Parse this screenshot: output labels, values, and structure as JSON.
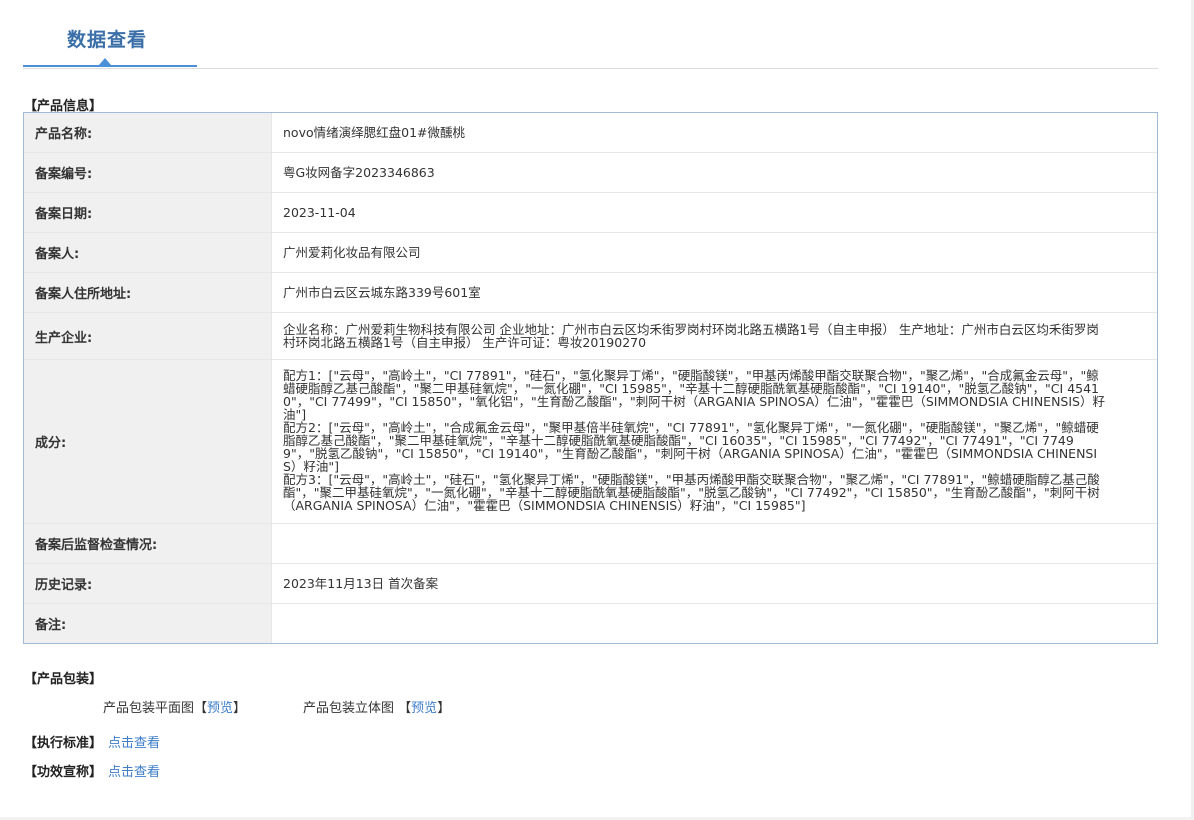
{
  "header": {
    "tab_title": "数据查看"
  },
  "product_info": {
    "section_title": "【产品信息】",
    "rows": [
      {
        "label": "产品名称:",
        "value": "novo情绪演绎腮红盘01#微醺桃"
      },
      {
        "label": "备案编号:",
        "value": "粤G妆网备字2023346863"
      },
      {
        "label": "备案日期:",
        "value": "2023-11-04"
      },
      {
        "label": "备案人:",
        "value": "广州爱莉化妆品有限公司"
      },
      {
        "label": "备案人住所地址:",
        "value": "广州市白云区云城东路339号601室"
      },
      {
        "label": "生产企业:",
        "value": "企业名称：广州爱莉生物科技有限公司 企业地址：广州市白云区均禾街罗岗村环岗北路五横路1号（自主申报） 生产地址：广州市白云区均禾街罗岗村环岗北路五横路1号（自主申报） 生产许可证：粤妆20190270"
      },
      {
        "label": "成分:",
        "value_lines": [
          "配方1：[\"云母\"，\"高岭土\"，\"CI 77891\"，\"硅石\"，\"氢化聚异丁烯\"，\"硬脂酸镁\"，\"甲基丙烯酸甲酯交联聚合物\"，\"聚乙烯\"，\"合成氟金云母\"，\"鲸蜡硬脂醇乙基己酸酯\"，\"聚二甲基硅氧烷\"，\"一氮化硼\"，\"CI 15985\"，\"辛基十二醇硬脂酰氧基硬脂酸酯\"，\"CI 19140\"，\"脱氢乙酸钠\"，\"CI 45410\"，\"CI 77499\"，\"CI 15850\"，\"氧化铝\"，\"生育酚乙酸酯\"，\"刺阿干树（ARGANIA SPINOSA）仁油\"，\"霍霍巴（SIMMONDSIA CHINENSIS）籽油\"]",
          "配方2：[\"云母\"，\"高岭土\"，\"合成氟金云母\"，\"聚甲基倍半硅氧烷\"，\"CI 77891\"，\"氢化聚异丁烯\"，\"一氮化硼\"，\"硬脂酸镁\"，\"聚乙烯\"，\"鲸蜡硬脂醇乙基己酸酯\"，\"聚二甲基硅氧烷\"，\"辛基十二醇硬脂酰氧基硬脂酸酯\"，\"CI 16035\"，\"CI 15985\"，\"CI 77492\"，\"CI 77491\"，\"CI 77499\"，\"脱氢乙酸钠\"，\"CI 15850\"，\"CI 19140\"，\"生育酚乙酸酯\"，\"刺阿干树（ARGANIA SPINOSA）仁油\"，\"霍霍巴（SIMMONDSIA CHINENSIS）籽油\"]",
          "配方3：[\"云母\"，\"高岭土\"，\"硅石\"，\"氢化聚异丁烯\"，\"硬脂酸镁\"，\"甲基丙烯酸甲酯交联聚合物\"，\"聚乙烯\"，\"CI 77891\"，\"鲸蜡硬脂醇乙基己酸酯\"，\"聚二甲基硅氧烷\"，\"一氮化硼\"，\"辛基十二醇硬脂酰氧基硬脂酸酯\"，\"脱氢乙酸钠\"，\"CI 77492\"，\"CI 15850\"，\"生育酚乙酸酯\"，\"刺阿干树（ARGANIA SPINOSA）仁油\"，\"霍霍巴（SIMMONDSIA CHINENSIS）籽油\"，\"CI 15985\"]"
        ]
      },
      {
        "label": "备案后监督检查情况:",
        "value": ""
      },
      {
        "label": "历史记录:",
        "value": "2023年11月13日 首次备案"
      },
      {
        "label": "备注:",
        "value": ""
      }
    ]
  },
  "packaging": {
    "section_title": "【产品包装】",
    "flat_label": "产品包装平面图",
    "solid_label": "产品包装立体图",
    "open_bracket": "【",
    "close_bracket": "】",
    "preview_link": "预览"
  },
  "standards": {
    "label": "【执行标准】",
    "link": "点击查看"
  },
  "efficacy": {
    "label": "【功效宣称】",
    "link": "点击查看"
  }
}
